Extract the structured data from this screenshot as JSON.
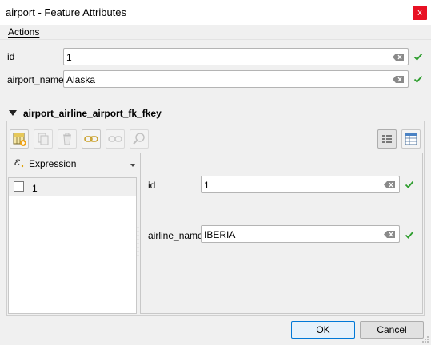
{
  "window": {
    "title": "airport - Feature Attributes",
    "close_glyph": "x"
  },
  "menu": {
    "actions_label": "Actions"
  },
  "fields": [
    {
      "label": "id",
      "value": "1"
    },
    {
      "label": "airport_name",
      "value": "Alaska"
    }
  ],
  "relation": {
    "title": "airport_airline_airport_fk_fkey",
    "toolbar": [
      {
        "icon": "add-child-feature-icon",
        "enabled": true
      },
      {
        "icon": "duplicate-feature-icon",
        "enabled": false
      },
      {
        "icon": "delete-feature-icon",
        "enabled": false
      },
      {
        "icon": "link-feature-icon",
        "enabled": true
      },
      {
        "icon": "unlink-feature-icon",
        "enabled": false
      },
      {
        "icon": "zoom-to-feature-icon",
        "enabled": false
      }
    ],
    "view_toggles": [
      {
        "icon": "form-view-icon",
        "active": true
      },
      {
        "icon": "table-view-icon",
        "active": false
      }
    ],
    "expression_label": "Expression",
    "list_items": [
      "1"
    ],
    "child_fields": [
      {
        "label": "id",
        "value": "1"
      },
      {
        "label": "airline_name",
        "value": "IBERIA"
      }
    ]
  },
  "buttons": {
    "ok": "OK",
    "cancel": "Cancel"
  },
  "colors": {
    "valid_check": "#2e9e2e",
    "close_bg": "#e81123",
    "default_button_border": "#0078d7"
  }
}
